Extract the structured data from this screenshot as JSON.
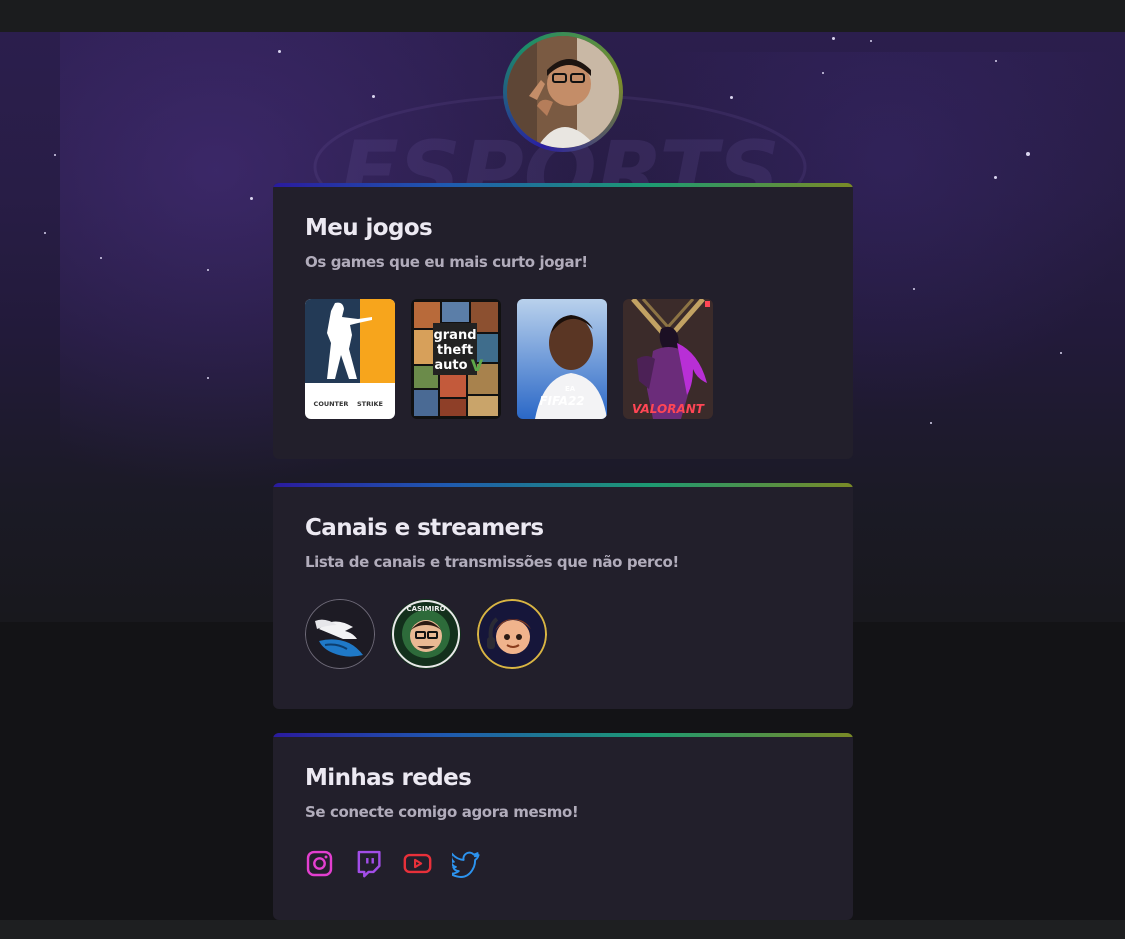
{
  "sections": {
    "games": {
      "title": "Meu jogos",
      "subtitle": "Os games que eu mais curto jogar!",
      "items": [
        {
          "name": "Counter-Strike",
          "cover_text_1": "COUNTER",
          "cover_text_2": "STRIKE"
        },
        {
          "name": "Grand Theft Auto V",
          "cover_text_1": "grand",
          "cover_text_2": "theft",
          "cover_text_3": "auto"
        },
        {
          "name": "FIFA 22",
          "cover_text_1": "FIFA22"
        },
        {
          "name": "Valorant",
          "cover_text_1": "VALORANT"
        }
      ]
    },
    "streamers": {
      "title": "Canais e streamers",
      "subtitle": "Lista de canais e transmissões que não perco!",
      "items": [
        {
          "icon": "winged-shoe-icon"
        },
        {
          "icon": "casimiro-badge-icon",
          "badge_text": "CASIMIRO"
        },
        {
          "icon": "cartoon-streamer-icon"
        }
      ]
    },
    "socials": {
      "title": "Minhas redes",
      "subtitle": "Se conecte comigo agora mesmo!",
      "items": [
        {
          "icon": "instagram-icon",
          "color": "#e33fd0"
        },
        {
          "icon": "twitch-icon",
          "color": "#a24de8"
        },
        {
          "icon": "youtube-icon",
          "color": "#e8303a"
        },
        {
          "icon": "twitter-icon",
          "color": "#2c93ef"
        }
      ]
    }
  },
  "background": {
    "watermark": "ESPORTS"
  },
  "colors": {
    "card_bg": "#221f2b",
    "accent_gradient": [
      "#2a1b9e",
      "#1d9a72",
      "#7a8a26"
    ]
  }
}
